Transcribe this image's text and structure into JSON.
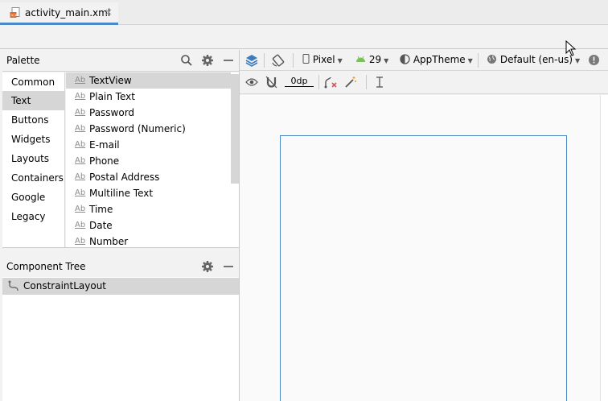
{
  "tab": {
    "filename": "activity_main.xml",
    "close": "×"
  },
  "palette": {
    "title": "Palette",
    "categories": [
      {
        "label": "Common"
      },
      {
        "label": "Text",
        "selected": true
      },
      {
        "label": "Buttons"
      },
      {
        "label": "Widgets"
      },
      {
        "label": "Layouts"
      },
      {
        "label": "Containers"
      },
      {
        "label": "Google"
      },
      {
        "label": "Legacy"
      }
    ],
    "item_prefix": "Ab",
    "items": [
      {
        "label": "TextView",
        "selected": true
      },
      {
        "label": "Plain Text"
      },
      {
        "label": "Password"
      },
      {
        "label": "Password (Numeric)"
      },
      {
        "label": "E-mail"
      },
      {
        "label": "Phone"
      },
      {
        "label": "Postal Address"
      },
      {
        "label": "Multiline Text"
      },
      {
        "label": "Time"
      },
      {
        "label": "Date"
      },
      {
        "label": "Number"
      }
    ]
  },
  "component_tree": {
    "title": "Component Tree",
    "root": "ConstraintLayout"
  },
  "design_toolbar": {
    "device": "Pixel",
    "api_level": "29",
    "theme": "AppTheme",
    "locale": "Default (en-us)",
    "margin": "0dp"
  },
  "colors": {
    "accent": "#4a88c7",
    "selection": "#d6d6d6",
    "android_green": "#78c257",
    "error_red": "#e05252"
  },
  "icons": [
    "search-icon",
    "gear-icon",
    "minimize-icon",
    "layers-icon",
    "orientation-icon",
    "phone-icon",
    "android-icon",
    "theme-icon",
    "globe-icon",
    "warning-icon",
    "eye-icon",
    "magnet-icon",
    "clear-constraints-icon",
    "magic-wand-icon",
    "guidelines-icon"
  ]
}
